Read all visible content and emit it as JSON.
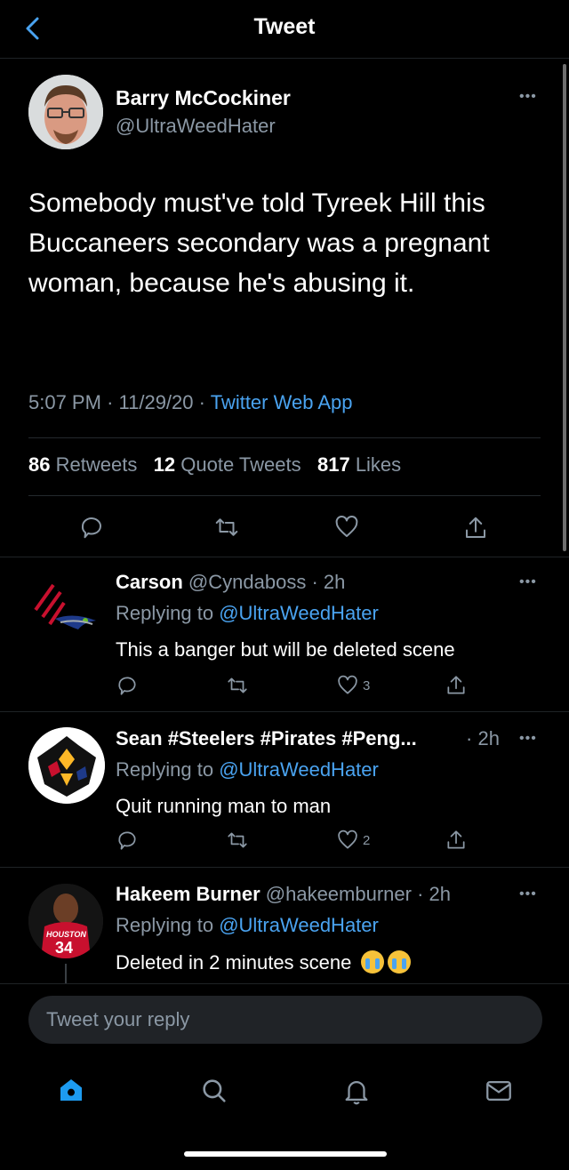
{
  "header": {
    "title": "Tweet"
  },
  "main_tweet": {
    "author_name": "Barry McCockiner",
    "author_handle": "@UltraWeedHater",
    "text": "Somebody must've told Tyreek Hill this Buccaneers secondary was a pregnant woman, because he's abusing it.",
    "time": "5:07 PM",
    "date": "11/29/20",
    "sep": "·",
    "source": "Twitter Web App",
    "retweets_count": "86",
    "retweets_label": "Retweets",
    "quotes_count": "12",
    "quotes_label": "Quote Tweets",
    "likes_count": "817",
    "likes_label": "Likes"
  },
  "replies": [
    {
      "name": "Carson",
      "handle": "@Cyndaboss",
      "time": "2h",
      "replying_label": "Replying to",
      "replying_to": "@UltraWeedHater",
      "text": "This a banger but will be deleted scene",
      "likes": "3"
    },
    {
      "name": "Sean #Steelers #Pirates #Peng...",
      "handle": "",
      "time": "2h",
      "replying_label": "Replying to",
      "replying_to": "@UltraWeedHater",
      "text": "Quit running man to man",
      "likes": "2"
    },
    {
      "name": "Hakeem Burner",
      "handle": "@hakeemburner",
      "time": "2h",
      "replying_label": "Replying to",
      "replying_to": "@UltraWeedHater",
      "text": "Deleted in 2 minutes scene",
      "avatar_jersey_text": "HOUSTON",
      "avatar_jersey_number": "34"
    }
  ],
  "reply_box": {
    "placeholder": "Tweet your reply"
  },
  "tabbar": {
    "items": [
      "home-icon",
      "search-icon",
      "notifications-icon",
      "messages-icon"
    ]
  },
  "colors": {
    "background": "#000000",
    "accent": "#4aa3f0",
    "muted": "#8b98a5"
  }
}
